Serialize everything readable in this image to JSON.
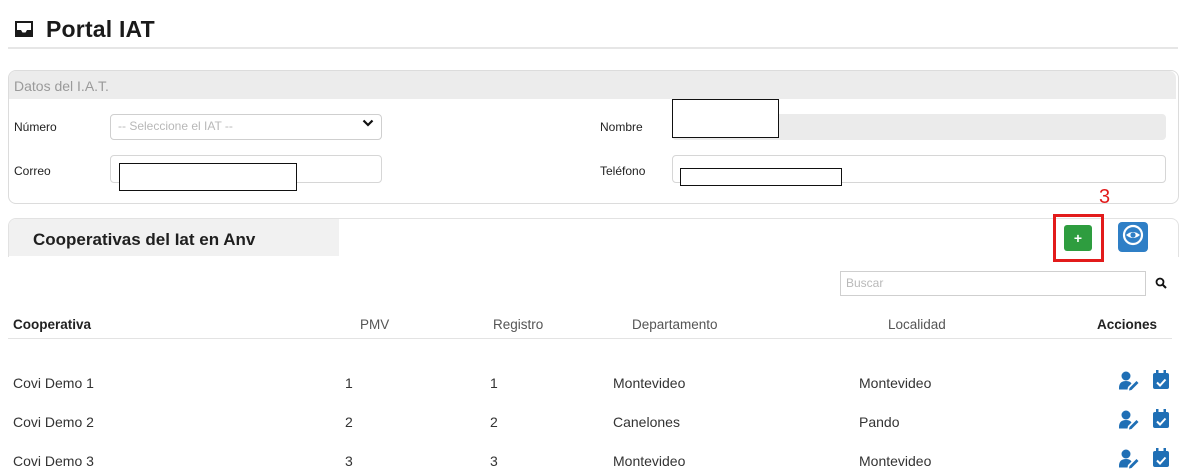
{
  "app": {
    "title": "Portal IAT"
  },
  "iat_panel": {
    "heading": "Datos del I.A.T.",
    "numero_label": "Número",
    "numero_placeholder": "-- Seleccione el IAT --",
    "nombre_label": "Nombre",
    "correo_label": "Correo",
    "telefono_label": "Teléfono"
  },
  "cooperativas": {
    "title": "Cooperativas del Iat en Anv",
    "annotation": "3",
    "add_button_label": "+",
    "search_placeholder": "Buscar",
    "columns": [
      "Cooperativa",
      "PMV",
      "Registro",
      "Departamento",
      "Localidad",
      "Acciones"
    ],
    "rows": [
      {
        "cooperativa": "Covi Demo 1",
        "pmv": "1",
        "registro": "1",
        "departamento": "Montevideo",
        "localidad": "Montevideo"
      },
      {
        "cooperativa": "Covi Demo 2",
        "pmv": "2",
        "registro": "2",
        "departamento": "Canelones",
        "localidad": "Pando"
      },
      {
        "cooperativa": "Covi Demo 3",
        "pmv": "3",
        "registro": "3",
        "departamento": "Montevideo",
        "localidad": "Montevideo"
      }
    ]
  },
  "colors": {
    "add": "#2e9d3f",
    "view": "#2f7fc6",
    "annotation": "#e21b1b",
    "action_icons": "#1f6fb5"
  },
  "icons": [
    "inbox-icon",
    "chevron-down-icon",
    "eye-icon",
    "search-icon",
    "user-edit-icon",
    "calendar-icon"
  ]
}
